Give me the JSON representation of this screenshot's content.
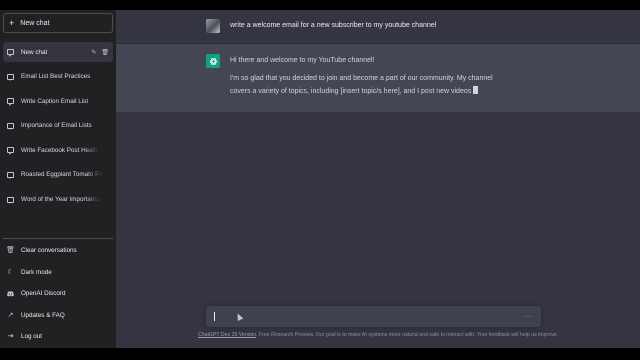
{
  "sidebar": {
    "new_chat_label": "New chat",
    "items": [
      {
        "label": "New chat",
        "active": true
      },
      {
        "label": "Email List Best Practices"
      },
      {
        "label": "Write Caption Email List"
      },
      {
        "label": "Importance of Email Lists"
      },
      {
        "label": "Write Facebook Post Health"
      },
      {
        "label": "Roasted Eggplant Tomato Pa"
      },
      {
        "label": "Word of the Year Importance"
      }
    ],
    "bottom": [
      {
        "label": "Clear conversations",
        "icon": "trash-icon"
      },
      {
        "label": "Dark mode",
        "icon": "moon-icon"
      },
      {
        "label": "OpenAI Discord",
        "icon": "discord-icon"
      },
      {
        "label": "Updates & FAQ",
        "icon": "external-link-icon"
      },
      {
        "label": "Log out",
        "icon": "logout-icon"
      }
    ]
  },
  "conversation": {
    "user_message": "write a welcome email for a new subscriber to my youtube channel",
    "assistant_paragraphs": [
      "Hi there and welcome to my YouTube channel!",
      "I'm so glad that you decided to join and become a part of our community. My channel covers a variety of topics, including [insert topic/s here], and I post new videos"
    ]
  },
  "composer": {
    "value": "",
    "placeholder": ""
  },
  "footer": {
    "version_link": "ChatGPT Dec 15 Version",
    "text": ". Free Research Preview. Our goal is to make AI systems more natural and safe to interact with. Your feedback will help us improve."
  },
  "colors": {
    "sidebar_bg": "#202123",
    "main_bg": "#343541",
    "assistant_bg": "#444654",
    "accent": "#10a37f"
  }
}
